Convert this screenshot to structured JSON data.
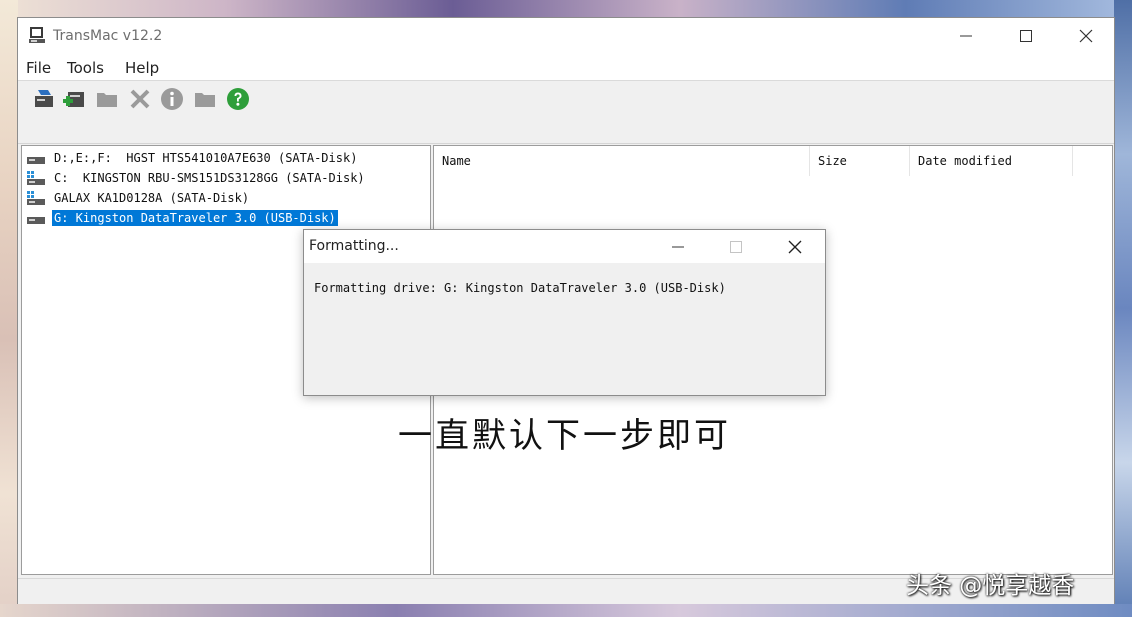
{
  "window": {
    "title": "TransMac v12.2",
    "minimize_icon": "minimize-icon",
    "maximize_icon": "maximize-icon",
    "close_icon": "close-icon"
  },
  "menu": {
    "items": [
      "File",
      "Tools",
      "Help"
    ]
  },
  "toolbar": {
    "buttons": [
      {
        "icon": "open-disk-icon"
      },
      {
        "icon": "add-disk-icon"
      },
      {
        "icon": "folder-icon"
      },
      {
        "icon": "delete-icon"
      },
      {
        "icon": "info-icon"
      },
      {
        "icon": "folder-icon"
      },
      {
        "icon": "help-icon"
      }
    ]
  },
  "drives": [
    {
      "label": "D:,E:,F:  HGST HTS541010A7E630 (SATA-Disk)",
      "icon": "hard-drive-icon",
      "selected": false
    },
    {
      "label": "C:  KINGSTON RBU-SMS151DS3128GG (SATA-Disk)",
      "icon": "windows-drive-icon",
      "selected": false
    },
    {
      "label": "GALAX KA1D0128A (SATA-Disk)",
      "icon": "windows-drive-icon",
      "selected": false
    },
    {
      "label": "G: Kingston DataTraveler 3.0 (USB-Disk)",
      "icon": "usb-drive-icon",
      "selected": true
    }
  ],
  "file_list": {
    "columns": [
      "Name",
      "Size",
      "Date modified"
    ]
  },
  "dialog": {
    "title": "Formatting...",
    "message": "Formatting drive: G: Kingston DataTraveler 3.0 (USB-Disk)"
  },
  "caption": "一直默认下一步即可",
  "watermark": "头条 @悦享越香",
  "colors": {
    "selection": "#0078d7",
    "help_green": "#2e9e3a"
  }
}
